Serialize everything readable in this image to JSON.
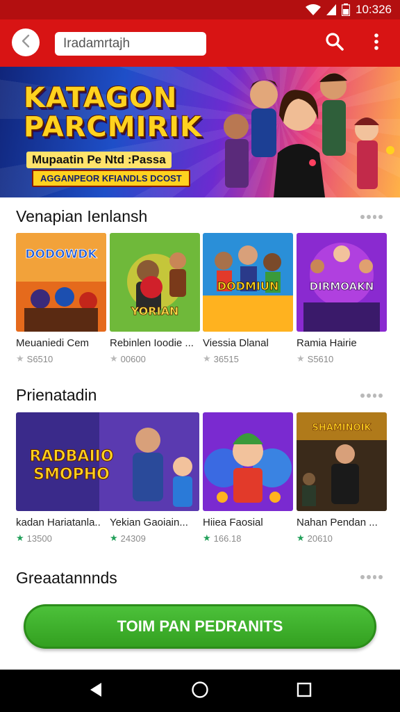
{
  "status_bar": {
    "time": "10:326"
  },
  "app_bar": {
    "search_value": "Iradamrtajh",
    "icons": [
      "back-arrow-icon",
      "search-icon",
      "more-vertical-icon"
    ]
  },
  "banner": {
    "title": "KATAGON\nPARCMIRIK",
    "subtitle": "Mupaatin Pe Ntd :Passa",
    "ribbon": "AGGANPEOR KFIANDLS DCOST"
  },
  "sections": [
    {
      "title": "Venapian Ienlansh",
      "items": [
        {
          "art_text": "DODOWDK",
          "name": "Meuaniedi Cem",
          "rating": "S6510",
          "star_color": "#b9b9b9"
        },
        {
          "art_text": "YORIAN",
          "name": "Rebinlen Ioodie ...",
          "rating": "00600",
          "star_color": "#b9b9b9"
        },
        {
          "art_text": "DODMIUN",
          "name": "Viessia Dlanal",
          "rating": "36515",
          "star_color": "#b9b9b9"
        },
        {
          "art_text": "DIRMOAKN",
          "name": "Ramia Hairie",
          "rating": "S5610",
          "star_color": "#b9b9b9"
        }
      ]
    },
    {
      "title": "Prienatadin",
      "items": [
        {
          "art_text": "RADBAIIO\nSMOPHO",
          "name": "kadan Hariatanla..",
          "rating": "13500",
          "star_color": "#22a05a"
        },
        {
          "art_text": "",
          "name": "Yekian Gaoiain...",
          "rating": "24309",
          "star_color": "#22a05a"
        },
        {
          "art_text": "",
          "name": "Hiiea Faosial",
          "rating": "166.18",
          "star_color": "#22a05a"
        },
        {
          "art_text": "SHAMINOIK",
          "name": "Nahan Pendan ...",
          "rating": "20610",
          "star_color": "#22a05a"
        }
      ]
    },
    {
      "title": "Greaatannnds"
    }
  ],
  "cta": {
    "label": "TOIM PAN PEDRANITS"
  },
  "nav": {
    "icons": [
      "back-triangle-icon",
      "home-circle-icon",
      "recents-square-icon"
    ]
  }
}
